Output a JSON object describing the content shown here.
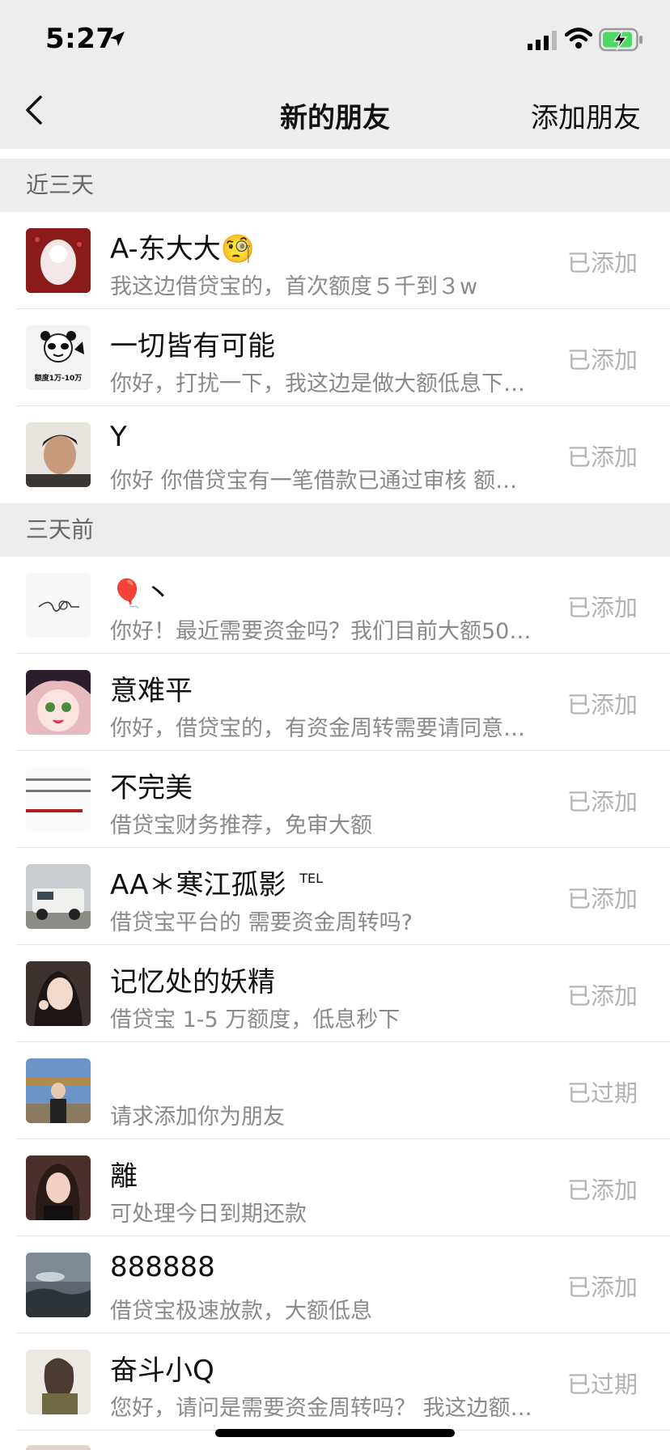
{
  "status_bar": {
    "time": "5:27"
  },
  "nav": {
    "title": "新的朋友",
    "action": "添加朋友"
  },
  "sections": [
    {
      "header": "近三天"
    },
    {
      "header": "三天前"
    }
  ],
  "requests": [
    {
      "name": "A-东大大🧐",
      "message": "我这边借贷宝的，首次额度５千到３w",
      "status": "已添加",
      "avatar_color": "#8b1a1a"
    },
    {
      "name": "一切皆有可能",
      "message": "你好，打扰一下，我这边是做大额低息下…",
      "status": "已添加",
      "avatar_color": "#f4f4f4",
      "avatar_caption": "额度1万-10万"
    },
    {
      "name": "Y",
      "message": "你好 你借贷宝有一笔借款已通过审核 额…",
      "status": "已添加",
      "avatar_color": "#6b5446"
    },
    {
      "name": "🎈丶",
      "message": "你好！最近需要资金吗？我们目前大额50…",
      "status": "已添加",
      "avatar_color": "#f7f7f7"
    },
    {
      "name": "意难平",
      "message": "你好，借贷宝的，有资金周转需要请同意…",
      "status": "已添加",
      "avatar_color": "#e9b9c0"
    },
    {
      "name": "不完美",
      "message": "借贷宝财务推荐，免审大额",
      "status": "已添加",
      "avatar_color": "#fafafa"
    },
    {
      "name": "AA＊寒江孤影",
      "name_sup": "TEL",
      "message": "借贷宝平台的  需要资金周转吗?",
      "status": "已添加",
      "avatar_color": "#9aa3a5"
    },
    {
      "name": "记忆处的妖精",
      "message": "借贷宝 1-5 万额度，低息秒下",
      "status": "已添加",
      "avatar_color": "#3b3230"
    },
    {
      "name": "",
      "message": "请求添加你为朋友",
      "status": "已过期",
      "avatar_color": "#6d94c8"
    },
    {
      "name": "離",
      "message": "可处理今日到期还款",
      "status": "已添加",
      "avatar_color": "#4a2f2a"
    },
    {
      "name": "888888",
      "message": "借贷宝极速放款，大额低息",
      "status": "已添加",
      "avatar_color": "#5d6670"
    },
    {
      "name": "奋斗小Q",
      "message": "您好，请问是需要资金周转吗？  我这边额…",
      "status": "已过期",
      "avatar_color": "#c2b49e"
    }
  ]
}
